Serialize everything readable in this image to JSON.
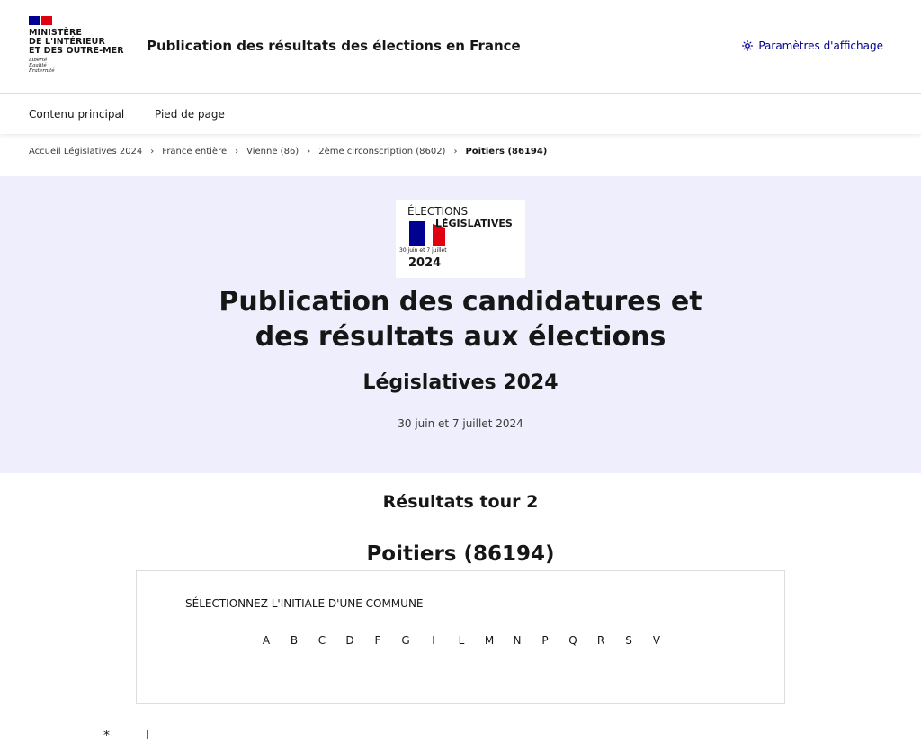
{
  "header": {
    "ministry_name": "MINISTÈRE\nDE L'INTÉRIEUR\nET DES OUTRE-MER",
    "motto": "Liberté\nÉgalité\nFraternité",
    "site_title": "Publication des résultats des élections en France",
    "display_settings_label": "Paramètres d'affichage",
    "display_settings_icon": "sun-icon",
    "accent_color": "#000091"
  },
  "skiplinks": {
    "main_content": "Contenu principal",
    "footer": "Pied de page"
  },
  "breadcrumb": {
    "items": [
      "Accueil Législatives 2024",
      "France entière",
      "Vienne (86)",
      "2ème circonscription (8602)"
    ],
    "current": "Poitiers (86194)"
  },
  "hero": {
    "badge": {
      "line1": "ÉLECTIONS",
      "line2": "LÉGISLATIVES",
      "dates": "30 juin et 7 juillet",
      "year": "2024"
    },
    "title": "Publication des candidatures et des résultats aux élections",
    "subtitle": "Législatives 2024",
    "date": "30 juin et 7 juillet 2024",
    "background": "#eeeefc"
  },
  "results": {
    "round_title": "Résultats tour 2",
    "commune_title": "Poitiers (86194)",
    "letters_label": "SÉLECTIONNEZ L'INITIALE D'UNE COMMUNE",
    "letters": [
      "A",
      "B",
      "C",
      "D",
      "F",
      "G",
      "I",
      "L",
      "M",
      "N",
      "P",
      "Q",
      "R",
      "S",
      "V"
    ]
  }
}
